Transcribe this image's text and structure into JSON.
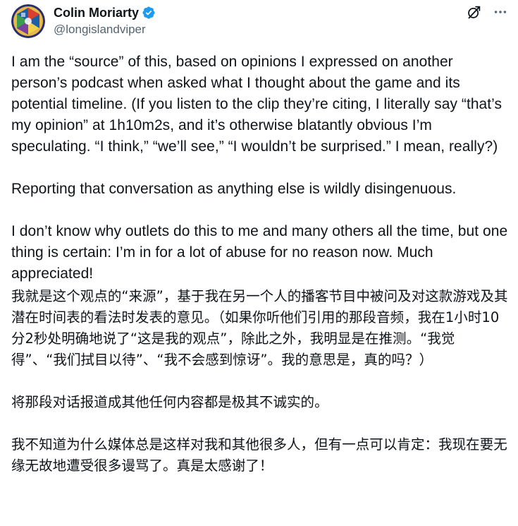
{
  "author": {
    "name": "Colin Moriarty",
    "handle": "@longislandviper",
    "verified": true
  },
  "icons": {
    "verified": "verified-badge-icon",
    "grok": "grok-icon",
    "more": "more-options-icon"
  },
  "colors": {
    "text": "#0f1419",
    "secondary": "#536471",
    "verified_blue": "#1d9bf0"
  },
  "tweet": {
    "en": {
      "p1": "I am the “source” of this, based on opinions I expressed on another person’s podcast when asked what I thought about the game and its potential timeline. (If you listen to the clip they’re citing, I literally say “that’s my opinion” at 1h10m2s, and it’s otherwise blatantly obvious I’m speculating. “I think,” “we’ll see,” “I wouldn’t be surprised.” I mean, really?)",
      "p2": "Reporting that conversation as anything else is wildly disingenuous.",
      "p3": "I don’t know why outlets do this to me and many others all the time, but one thing is certain: I’m in for a lot of abuse for no reason now. Much appreciated!"
    },
    "zh": {
      "p1": "我就是这个观点的“来源”，基于我在另一个人的播客节目中被问及对这款游戏及其潜在时间表的看法时发表的意见。（如果你听他们引用的那段音频，我在1小时10分2秒处明确地说了“这是我的观点”，除此之外，我明显是在推测。“我觉得”、“我们拭目以待”、“我不会感到惊讶”。我的意思是，真的吗？）",
      "p2": "将那段对话报道成其他任何内容都是极其不诚实的。",
      "p3": "我不知道为什么媒体总是这样对我和其他很多人，但有一点可以肯定：我现在要无缘无故地遭受很多谩骂了。真是太感谢了！"
    }
  }
}
